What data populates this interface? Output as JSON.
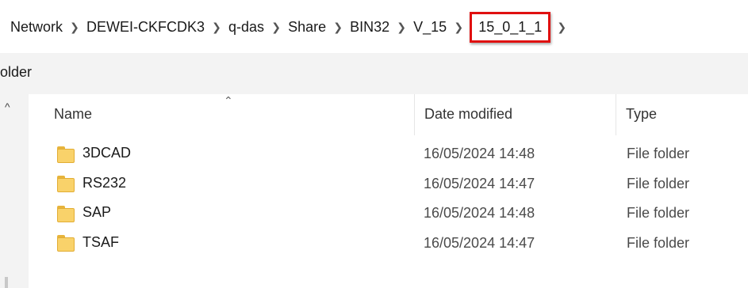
{
  "breadcrumb": {
    "items": [
      "Network",
      "DEWEI-CKFCDK3",
      "q-das",
      "Share",
      "BIN32",
      "V_15",
      "15_0_1_1"
    ],
    "separator_icon": "chevron-right-icon",
    "highlight_color": "#e01010"
  },
  "command_bar": {
    "new_folder_partial": "older"
  },
  "columns": {
    "name": "Name",
    "date_modified": "Date modified",
    "type": "Type",
    "sort_indicator_icon": "sort-ascending-icon"
  },
  "files": [
    {
      "name": "3DCAD",
      "date_modified": "16/05/2024 14:48",
      "type": "File folder",
      "icon": "folder-icon"
    },
    {
      "name": "RS232",
      "date_modified": "16/05/2024 14:47",
      "type": "File folder",
      "icon": "folder-icon"
    },
    {
      "name": "SAP",
      "date_modified": "16/05/2024 14:48",
      "type": "File folder",
      "icon": "folder-icon"
    },
    {
      "name": "TSAF",
      "date_modified": "16/05/2024 14:47",
      "type": "File folder",
      "icon": "folder-icon"
    }
  ],
  "colors": {
    "folder": "#f9d26a",
    "folder_edge": "#e2ad33",
    "command_bar_bg": "#f3f3f3"
  }
}
